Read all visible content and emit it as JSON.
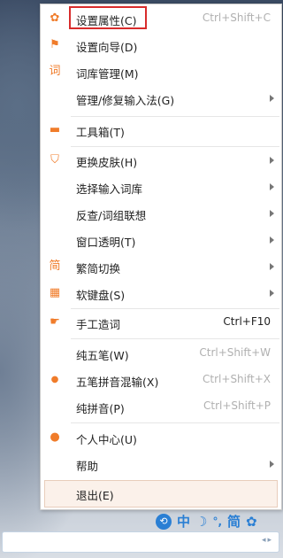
{
  "menu": {
    "items": [
      {
        "id": "settings",
        "icon": "gear-icon",
        "glyph": "✿",
        "label": "设置属性(C)",
        "shortcut": "Ctrl+Shift+C",
        "arrow": false
      },
      {
        "id": "wizard",
        "icon": "flag-icon",
        "glyph": "⚑",
        "label": "设置向导(D)",
        "shortcut": "",
        "arrow": false
      },
      {
        "id": "dict",
        "icon": "dictionary-icon",
        "glyph": "词",
        "label": "词库管理(M)",
        "shortcut": "",
        "arrow": false
      },
      {
        "id": "repair",
        "icon": "",
        "glyph": "",
        "label": "管理/修复输入法(G)",
        "shortcut": "",
        "arrow": true
      },
      {
        "id": "toolbox",
        "icon": "toolbox-icon",
        "glyph": "▬",
        "label": "工具箱(T)",
        "shortcut": "",
        "arrow": false
      },
      {
        "id": "skin",
        "icon": "shirt-icon",
        "glyph": "⛉",
        "label": "更换皮肤(H)",
        "shortcut": "",
        "arrow": true
      },
      {
        "id": "lexicon",
        "icon": "",
        "glyph": "",
        "label": "选择输入词库",
        "shortcut": "",
        "arrow": true
      },
      {
        "id": "lookup",
        "icon": "",
        "glyph": "",
        "label": "反查/词组联想",
        "shortcut": "",
        "arrow": true
      },
      {
        "id": "transparency",
        "icon": "",
        "glyph": "",
        "label": "窗口透明(T)",
        "shortcut": "",
        "arrow": true
      },
      {
        "id": "convert",
        "icon": "traditional-simplified-icon",
        "glyph": "简",
        "label": "繁简切换",
        "shortcut": "",
        "arrow": true
      },
      {
        "id": "softkb",
        "icon": "keyboard-icon",
        "glyph": "▦",
        "label": "软键盘(S)",
        "shortcut": "",
        "arrow": true
      },
      {
        "id": "manualword",
        "icon": "hand-icon",
        "glyph": "☛",
        "label": "手工造词",
        "shortcut": "Ctrl+F10",
        "arrow": false
      },
      {
        "id": "pure5",
        "icon": "",
        "glyph": "",
        "label": "纯五笔(W)",
        "shortcut": "Ctrl+Shift+W",
        "arrow": false
      },
      {
        "id": "mixed",
        "icon": "radio-dot-icon",
        "glyph": "●",
        "label": "五笔拼音混输(X)",
        "shortcut": "Ctrl+Shift+X",
        "arrow": false
      },
      {
        "id": "pinyin",
        "icon": "",
        "glyph": "",
        "label": "纯拼音(P)",
        "shortcut": "Ctrl+Shift+P",
        "arrow": false
      },
      {
        "id": "profile",
        "icon": "user-icon",
        "glyph": "●",
        "label": "个人中心(U)",
        "shortcut": "",
        "arrow": false
      },
      {
        "id": "help",
        "icon": "",
        "glyph": "",
        "label": "帮助",
        "shortcut": "",
        "arrow": true
      },
      {
        "id": "exit",
        "icon": "",
        "glyph": "",
        "label": "退出(E)",
        "shortcut": "",
        "arrow": false
      }
    ]
  },
  "toolbar": {
    "logo": "⟲",
    "lang": "中",
    "moon": "☽",
    "punct": "°,",
    "simple": "简",
    "settings": "✿"
  },
  "input": {
    "arrows": "◂▸"
  },
  "colors": {
    "accent": "#f07c2a",
    "highlight": "#d82c2c",
    "toolbar": "#2a7fd4"
  }
}
